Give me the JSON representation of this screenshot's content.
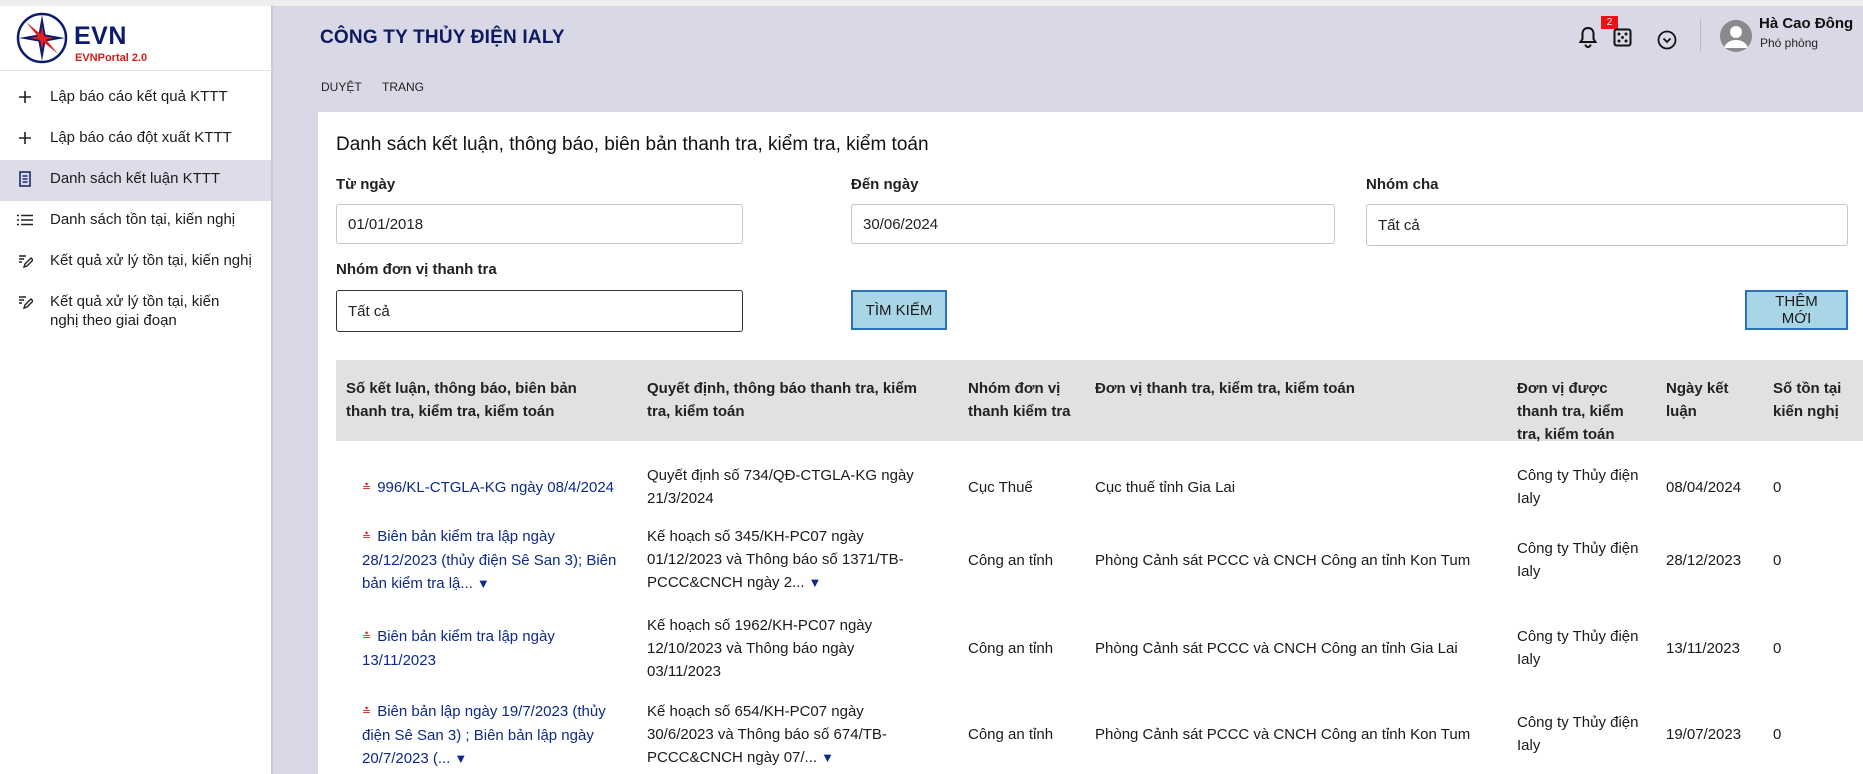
{
  "brand": {
    "name": "EVN",
    "portal": "EVNPortal 2.0"
  },
  "sidebar": {
    "items": [
      {
        "label": "Lập báo cáo kết quả KTTT",
        "icon": "plus-icon"
      },
      {
        "label": "Lập báo cáo đột xuất KTTT",
        "icon": "plus-icon"
      },
      {
        "label": "Danh sách kết luận KTTT",
        "icon": "document-icon",
        "active": true
      },
      {
        "label": "Danh sách tồn tại, kiến nghị",
        "icon": "list-icon"
      },
      {
        "label": "Kết quả xử lý tồn tại, kiến nghị",
        "icon": "edit-note-icon"
      },
      {
        "label": "Kết quả xử lý tồn tại, kiến nghị theo giai đoạn",
        "icon": "edit-note-icon"
      }
    ]
  },
  "header": {
    "company": "CÔNG TY THỦY ĐIỆN IALY",
    "notifications_count": "2",
    "user_name": "Hà Cao Đông",
    "user_role": "Phó phòng"
  },
  "subnav": {
    "items": [
      "DUYỆT",
      "TRANG"
    ]
  },
  "page": {
    "title": "Danh sách kết luận, thông báo, biên bản thanh tra, kiểm tra, kiểm toán",
    "filters": {
      "from_label": "Từ ngày",
      "from_value": "01/01/2018",
      "to_label": "Đến ngày",
      "to_value": "30/06/2024",
      "parent_group_label": "Nhóm cha",
      "parent_group_value": "Tất cả",
      "inspect_group_label": "Nhóm đơn vị thanh tra",
      "inspect_group_value": "Tất cả"
    },
    "search_button": "TÌM KIẾM",
    "add_button": "THÊM MỚI"
  },
  "table": {
    "headers": [
      "Số kết luận, thông báo, biên bản thanh tra, kiểm tra, kiểm toán",
      "Quyết định, thông báo thanh tra, kiểm tra, kiểm toán",
      "Nhóm đơn vị thanh kiểm tra",
      "Đơn vị thanh tra, kiểm tra, kiểm toán",
      "Đơn vị được thanh tra, kiểm tra, kiểm toán",
      "Ngày kết luận",
      "Số tồn tại kiến nghị"
    ],
    "rows": [
      {
        "number": "996/KL-CTGLA-KG ngày 08/4/2024",
        "decision": "Quyết định số 734/QĐ-CTGLA-KG ngày 21/3/2024",
        "group": "Cục Thuế",
        "unit": "Cục thuế tỉnh Gia Lai",
        "target": "Công ty Thủy điện Ialy",
        "date": "08/04/2024",
        "count": "0"
      },
      {
        "number": "Biên bản kiểm tra lập ngày 28/12/2023 (thủy điện Sê San 3); Biên bản kiểm tra lậ...",
        "decision": "Kế hoạch số 345/KH-PC07 ngày 01/12/2023 và Thông báo số 1371/TB-PCCC&CNCH ngày 2...",
        "group": "Công an tỉnh",
        "unit": "Phòng Cảnh sát PCCC và CNCH Công an tỉnh Kon Tum",
        "target": "Công ty Thủy điện Ialy",
        "date": "28/12/2023",
        "count": "0"
      },
      {
        "number": "Biên bản kiểm tra lập ngày 13/11/2023",
        "decision": "Kế hoạch số 1962/KH-PC07 ngày 12/10/2023 và Thông báo ngày 03/11/2023",
        "group": "Công an tỉnh",
        "unit": "Phòng Cảnh sát PCCC và CNCH Công an tỉnh Gia Lai",
        "target": "Công ty Thủy điện Ialy",
        "date": "13/11/2023",
        "count": "0"
      },
      {
        "number": "Biên bản lập ngày 19/7/2023 (thủy điện Sê San 3) ; Biên bản lập ngày 20/7/2023 (...",
        "decision": "Kế hoạch số 654/KH-PC07 ngày 30/6/2023 và Thông báo số 674/TB-PCCC&CNCH ngày 07/...",
        "group": "Công an tỉnh",
        "unit": "Phòng Cảnh sát PCCC và CNCH Công an tỉnh Kon Tum",
        "target": "Công ty Thủy điện Ialy",
        "date": "19/07/2023",
        "count": "0"
      }
    ]
  }
}
